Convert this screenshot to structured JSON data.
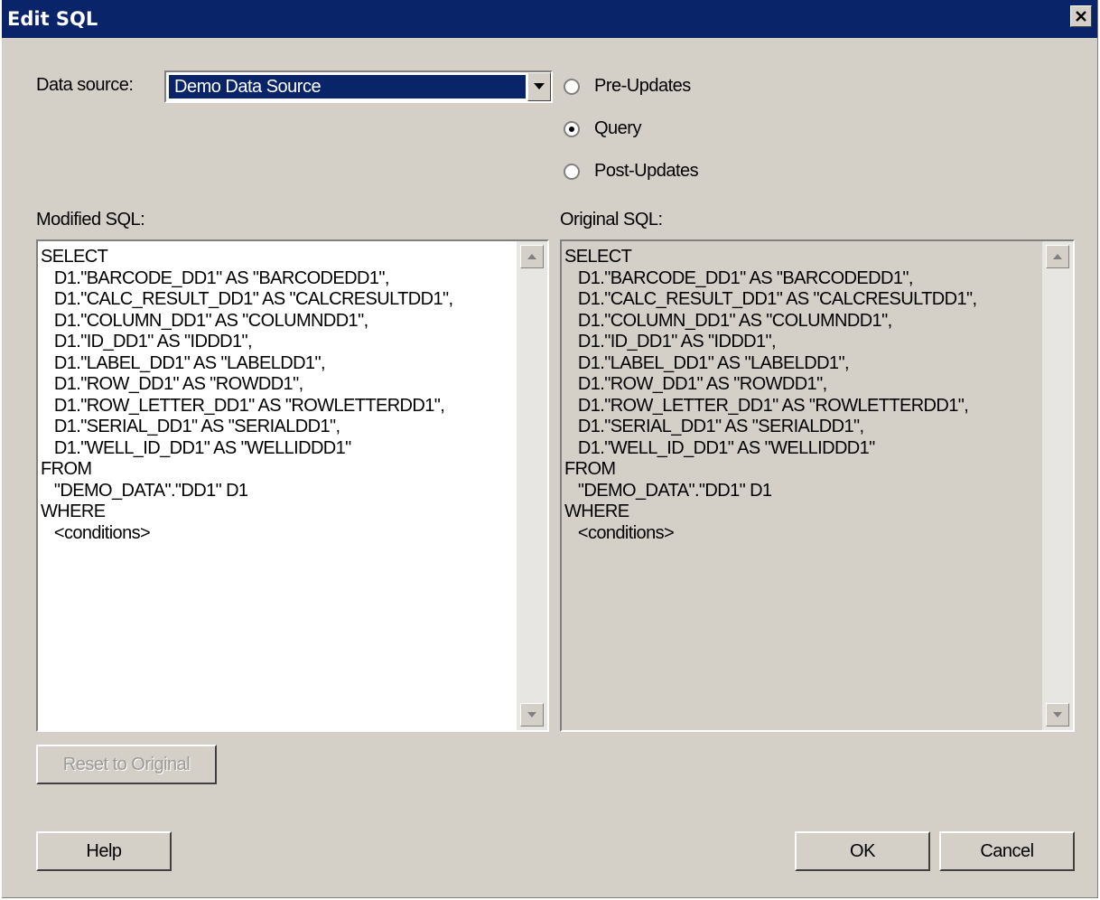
{
  "window": {
    "title": "Edit SQL"
  },
  "data_source": {
    "label": "Data source:",
    "selected": "Demo Data Source"
  },
  "mode": {
    "options": [
      {
        "label": "Pre-Updates",
        "checked": false
      },
      {
        "label": "Query",
        "checked": true
      },
      {
        "label": "Post-Updates",
        "checked": false
      }
    ]
  },
  "modified_sql": {
    "label": "Modified SQL:",
    "text": "SELECT\n   D1.\"BARCODE_DD1\" AS \"BARCODEDD1\",\n   D1.\"CALC_RESULT_DD1\" AS \"CALCRESULTDD1\",\n   D1.\"COLUMN_DD1\" AS \"COLUMNDD1\",\n   D1.\"ID_DD1\" AS \"IDDD1\",\n   D1.\"LABEL_DD1\" AS \"LABELDD1\",\n   D1.\"ROW_DD1\" AS \"ROWDD1\",\n   D1.\"ROW_LETTER_DD1\" AS \"ROWLETTERDD1\",\n   D1.\"SERIAL_DD1\" AS \"SERIALDD1\",\n   D1.\"WELL_ID_DD1\" AS \"WELLIDDD1\"\nFROM\n   \"DEMO_DATA\".\"DD1\" D1\nWHERE\n   <conditions>"
  },
  "original_sql": {
    "label": "Original SQL:",
    "text": "SELECT\n   D1.\"BARCODE_DD1\" AS \"BARCODEDD1\",\n   D1.\"CALC_RESULT_DD1\" AS \"CALCRESULTDD1\",\n   D1.\"COLUMN_DD1\" AS \"COLUMNDD1\",\n   D1.\"ID_DD1\" AS \"IDDD1\",\n   D1.\"LABEL_DD1\" AS \"LABELDD1\",\n   D1.\"ROW_DD1\" AS \"ROWDD1\",\n   D1.\"ROW_LETTER_DD1\" AS \"ROWLETTERDD1\",\n   D1.\"SERIAL_DD1\" AS \"SERIALDD1\",\n   D1.\"WELL_ID_DD1\" AS \"WELLIDDD1\"\nFROM\n   \"DEMO_DATA\".\"DD1\" D1\nWHERE\n   <conditions>"
  },
  "buttons": {
    "reset": "Reset to Original",
    "help": "Help",
    "ok": "OK",
    "cancel": "Cancel"
  },
  "colors": {
    "titlebar": "#0a246a",
    "dialog": "#d4d0c8",
    "selection": "#0a246a"
  }
}
